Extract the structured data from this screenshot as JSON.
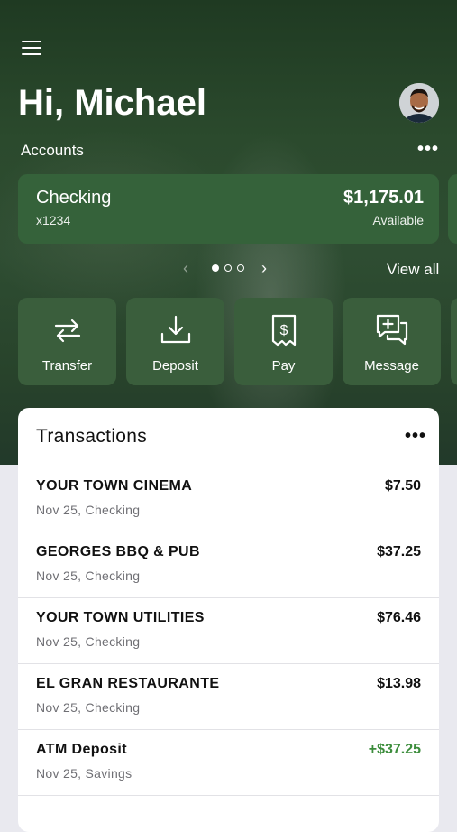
{
  "header": {
    "greeting": "Hi, Michael",
    "accounts_label": "Accounts"
  },
  "account": {
    "name": "Checking",
    "number": "x1234",
    "balance": "$1,175.01",
    "balance_label": "Available"
  },
  "pager": {
    "pages": 3,
    "current": 1,
    "view_all": "View all"
  },
  "actions": [
    {
      "label": "Transfer",
      "icon": "transfer-icon"
    },
    {
      "label": "Deposit",
      "icon": "deposit-icon"
    },
    {
      "label": "Pay",
      "icon": "bill-icon"
    },
    {
      "label": "Message",
      "icon": "message-icon"
    }
  ],
  "transactions": {
    "title": "Transactions",
    "items": [
      {
        "name": "YOUR TOWN CINEMA",
        "sub": "Nov 25, Checking",
        "amount": "$7.50",
        "credit": false
      },
      {
        "name": "GEORGES BBQ & PUB",
        "sub": "Nov 25, Checking",
        "amount": "$37.25",
        "credit": false
      },
      {
        "name": "YOUR TOWN UTILITIES",
        "sub": "Nov 25, Checking",
        "amount": "$76.46",
        "credit": false
      },
      {
        "name": "EL GRAN RESTAURANTE",
        "sub": "Nov 25, Checking",
        "amount": "$13.98",
        "credit": false
      },
      {
        "name": "ATM Deposit",
        "sub": "Nov 25, Savings",
        "amount": "+$37.25",
        "credit": true
      }
    ]
  },
  "colors": {
    "hero_green": "#2b4a2d",
    "card_green": "#35623a",
    "action_green": "#3a5e3c",
    "credit_green": "#3c8d3c"
  }
}
